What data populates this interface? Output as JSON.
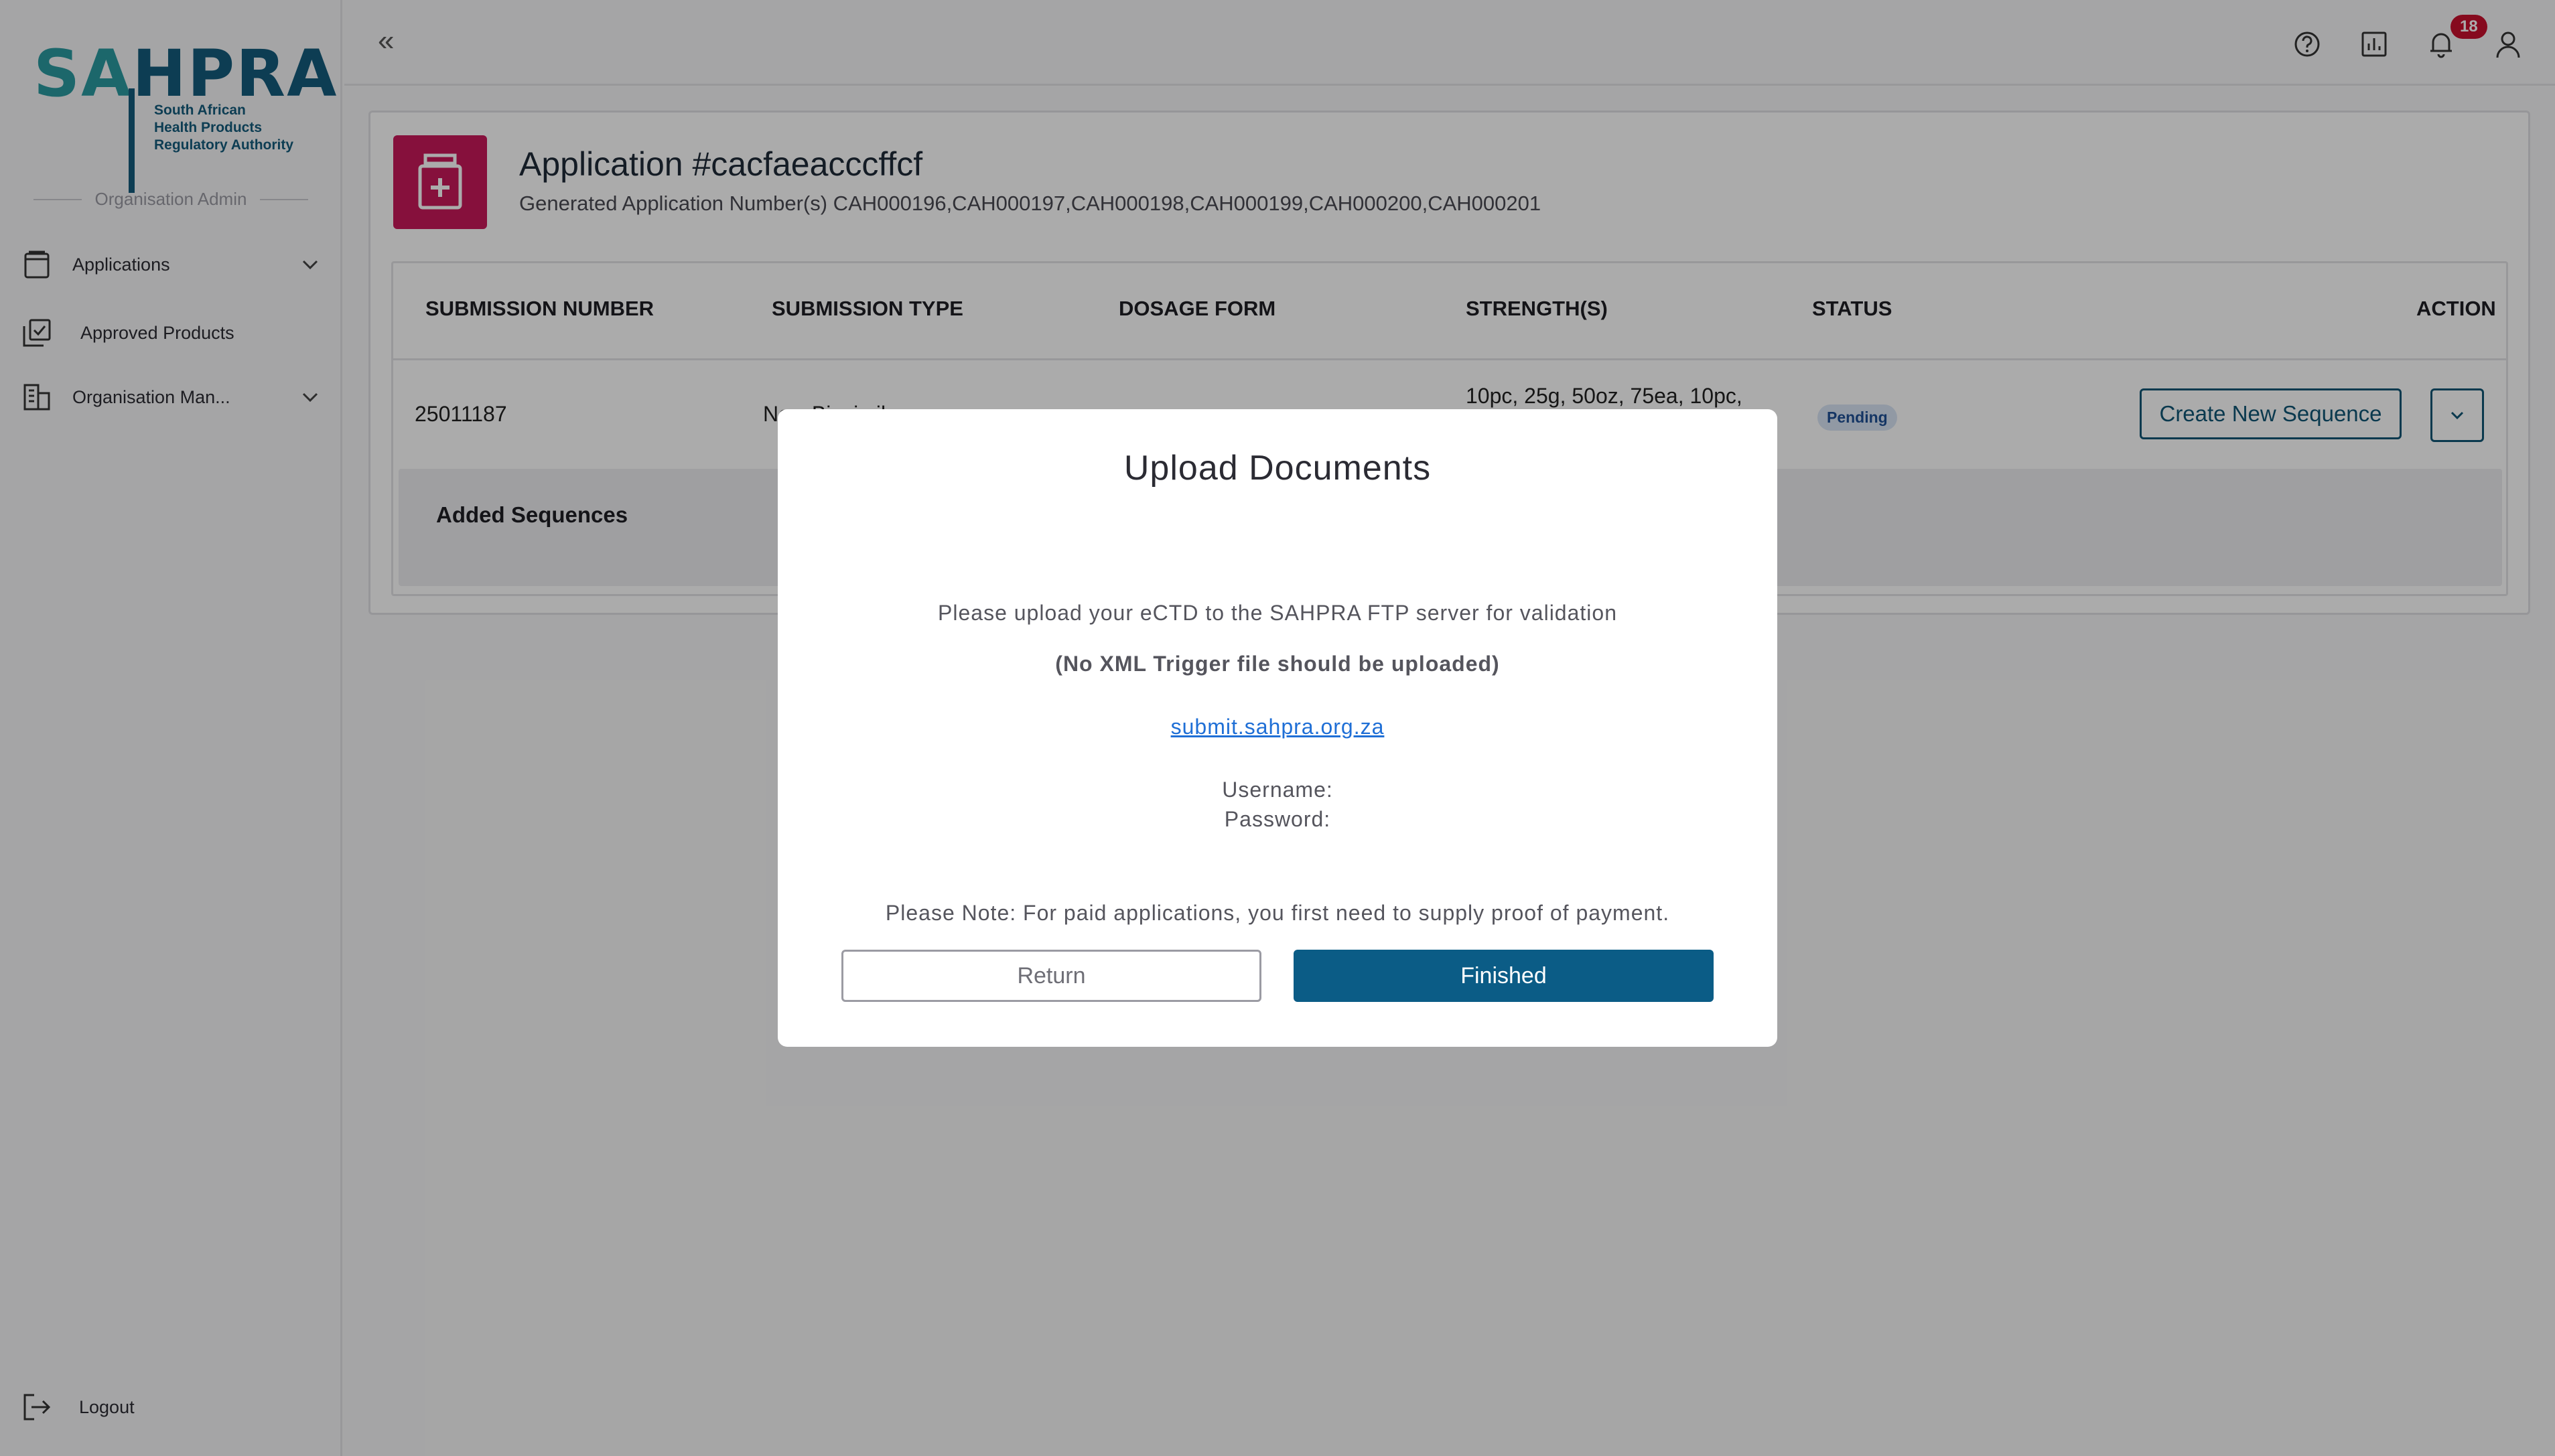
{
  "sidebar": {
    "logo": {
      "main_a": "SA",
      "main_b": "HPRA",
      "sub1": "South African",
      "sub2": "Health Products",
      "sub3": "Regulatory Authority"
    },
    "role": "Organisation Admin",
    "items": [
      {
        "label": "Applications",
        "icon": "applications-icon",
        "expandable": true
      },
      {
        "label": "Approved Products",
        "icon": "approved-products-icon",
        "expandable": false
      },
      {
        "label": "Organisation Man...",
        "icon": "building-icon",
        "expandable": true
      }
    ],
    "logout_label": "Logout"
  },
  "topbar": {
    "collapse_glyph": "«",
    "notifications_count": "18"
  },
  "application": {
    "title": "Application #cacfaeacccffcf",
    "subtitle": "Generated Application Number(s) CAH000196,CAH000197,CAH000198,CAH000199,CAH000200,CAH000201",
    "icon_color": "#c8195a",
    "table": {
      "headers": [
        "SUBMISSION NUMBER",
        "SUBMISSION TYPE",
        "DOSAGE FORM",
        "STRENGTH(S)",
        "STATUS",
        "ACTION"
      ],
      "row": {
        "submission_number": "25011187",
        "submission_type": "New Biosimilar",
        "dosage_form": "",
        "strengths": "10pc, 25g, 50oz, 75ea, 10pc,",
        "status": "Pending",
        "action_label": "Create New Sequence"
      },
      "added_sequences_label": "Added Sequences"
    }
  },
  "modal": {
    "title": "Upload Documents",
    "line1": "Please upload your eCTD to the SAHPRA FTP server for validation",
    "line2": "(No XML Trigger file should be uploaded)",
    "link": "submit.sahpra.org.za",
    "username_label": "Username:",
    "password_label": "Password:",
    "note": "Please Note: For paid applications, you first need to supply proof of payment.",
    "return_label": "Return",
    "finish_label": "Finished",
    "finish_color": "#0b5c86"
  }
}
